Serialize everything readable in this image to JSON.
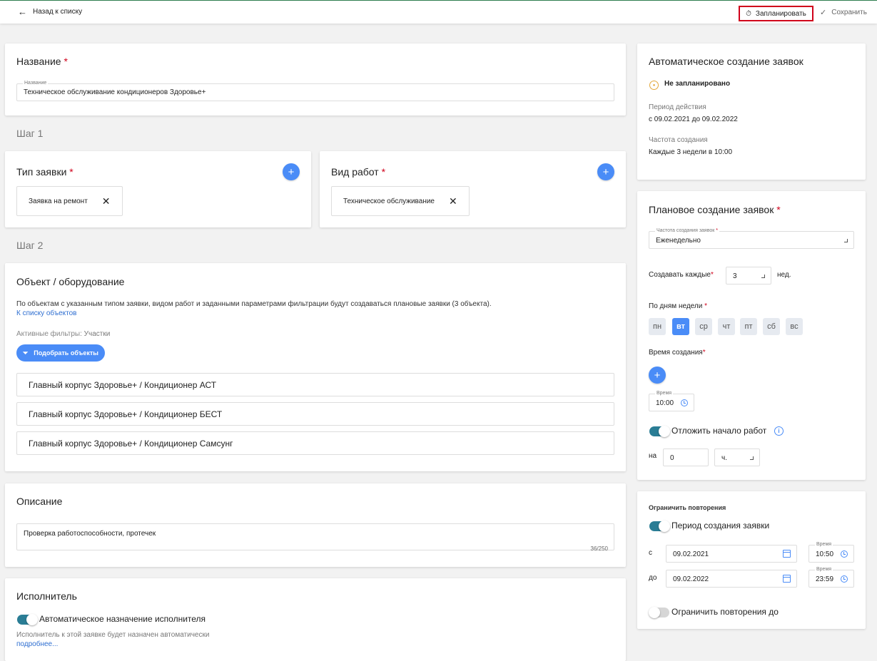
{
  "topbar": {
    "back_label": "Назад к списку",
    "plan_label": "Запланировать",
    "save_label": "Сохранить"
  },
  "name_card": {
    "title": "Название",
    "field_label": "Название",
    "field_value": "Техническое обслуживание кондиционеров Здоровье+"
  },
  "step1": "Шаг 1",
  "step2": "Шаг 2",
  "request_type": {
    "title": "Тип заявки",
    "chip": "Заявка на ремонт"
  },
  "work_type": {
    "title": "Вид работ",
    "chip": "Техническое обслуживание"
  },
  "objects": {
    "title": "Объект / оборудование",
    "description": "По объектам с указанным типом заявки, видом работ и заданными параметрами фильтрации будут создаваться плановые заявки (3 объекта).",
    "list_link": "К списку объектов",
    "filters_label": "Активные фильтры:",
    "filters_value": "Участки",
    "pick_button": "Подобрать объекты",
    "items": [
      "Главный корпус Здоровье+ / Кондиционер АСТ",
      "Главный корпус Здоровье+ / Кондиционер БЕСТ",
      "Главный корпус Здоровье+ / Кондиционер Самсунг"
    ]
  },
  "description": {
    "title": "Описание",
    "value": "Проверка работоспособности, протечек",
    "counter": "36/250"
  },
  "executor": {
    "title": "Исполнитель",
    "toggle_label": "Автоматическое назначение исполнителя",
    "hint": "Исполнитель к этой заявке будет назначен автоматически",
    "more_link": "подробнее..."
  },
  "auto": {
    "title": "Автоматическое создание заявок",
    "status": "Не запланировано",
    "period_label": "Период действия",
    "period_value": "с 09.02.2021 до 09.02.2022",
    "freq_label": "Частота создания",
    "freq_value": "Каждые 3 недели в 10:00"
  },
  "plan": {
    "title": "Плановое создание заявок",
    "freq_field_label": "Частота создания заявок",
    "freq_field_value": "Еженедельно",
    "every_label": "Создавать каждые",
    "every_value": "3",
    "every_unit": "нед.",
    "days_label": "По дням недели",
    "days": [
      "пн",
      "вт",
      "ср",
      "чт",
      "пт",
      "сб",
      "вс"
    ],
    "active_day": "вт",
    "time_label": "Время создания",
    "time_field_label": "Время",
    "time_value": "10:00",
    "delay_label": "Отложить начало работ",
    "delay_prefix": "на",
    "delay_value": "0",
    "delay_unit": "ч."
  },
  "limit": {
    "title": "Ограничить повторения",
    "period_toggle": "Период создания заявки",
    "from_label": "с",
    "from_date": "09.02.2021",
    "from_time_label": "Время",
    "from_time": "10:50",
    "to_label": "до",
    "to_date": "09.02.2022",
    "to_time_label": "Время",
    "to_time": "23:59",
    "limit_toggle": "Ограничить повторения до"
  },
  "colors": {
    "accent": "#4a8cf7",
    "toggle_on": "#2a7d95",
    "required": "#d0021b",
    "highlight_border": "#d0021b"
  }
}
